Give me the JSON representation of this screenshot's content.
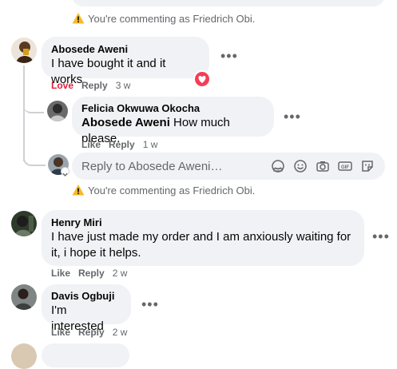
{
  "notice_text": "You're commenting as Friedrich Obi.",
  "comments": [
    {
      "author": "Abosede Aweni",
      "text": "I have bought it and it works",
      "actions": {
        "love": "Love",
        "reply": "Reply",
        "time": "3 w"
      },
      "replies": [
        {
          "author": "Felicia Okwuwa Okocha",
          "mention": "Abosede Aweni",
          "text": " How much please.",
          "actions": {
            "like": "Like",
            "reply": "Reply",
            "time": "1 w"
          }
        }
      ]
    },
    {
      "author": "Henry Miri",
      "text": "I have just made my order and I am anxiously waiting for it, i hope it helps.",
      "actions": {
        "like": "Like",
        "reply": "Reply",
        "time": "2 w"
      }
    },
    {
      "author": "Davis Ogbuji",
      "text": "I'm interested",
      "actions": {
        "like": "Like",
        "reply": "Reply",
        "time": "2 w"
      }
    }
  ],
  "reply_box": {
    "placeholder": "Reply to Abosede Aweni…"
  },
  "reply_icons": [
    "sticker-face-icon",
    "emoji-icon",
    "camera-icon",
    "gif-icon",
    "sticker-icon"
  ],
  "colors": {
    "bubble": "#f0f2f5",
    "muted": "#65676b",
    "love": "#e41e3f",
    "warning": "#f7b928"
  }
}
